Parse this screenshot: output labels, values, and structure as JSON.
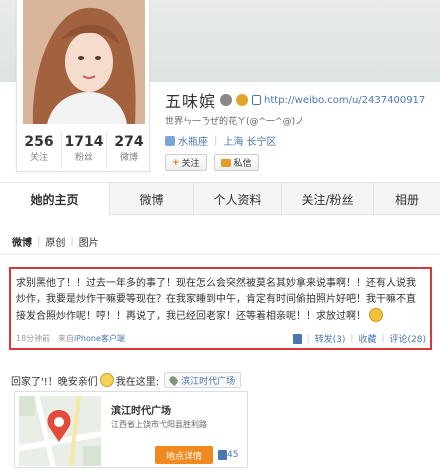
{
  "profile": {
    "name": "五味嫔",
    "weibo_url": "http://weibo.com/u/2437400917",
    "motto": "世界ㄣ一ㄋぜ的花ㄚ(@^一^@)ノ",
    "stats": [
      {
        "value": "256",
        "label": "关注"
      },
      {
        "value": "1714",
        "label": "粉丝"
      },
      {
        "value": "274",
        "label": "微博"
      }
    ],
    "tags": [
      "水瓶座",
      "上海 长宁区"
    ],
    "follow_label": "关注",
    "message_label": "私信"
  },
  "tabs": [
    {
      "label": "她的主页",
      "active": true
    },
    {
      "label": "微博",
      "active": false
    },
    {
      "label": "个人资料",
      "active": false
    },
    {
      "label": "关注/粉丝",
      "active": false
    },
    {
      "label": "相册",
      "active": false
    }
  ],
  "subnav": [
    "微博",
    "原创",
    "图片"
  ],
  "post": {
    "text": "求别黑他了！！过去一年多的事了！现在怎么会突然被莫名其妙拿来说事啊！！还有人说我炒作，我要是炒作干嘛要等现在？在我家睡到中午，肯定有时间偷拍照片好吧！我干嘛不直接发合照炒作呢！哼！！再说了，我已经回老家！还等着相亲呢！！求放过啊！",
    "time": "18分钟前",
    "source_prefix": "来自",
    "source": "iPhone客户端",
    "actions": {
      "like": "",
      "repost": "转发(3)",
      "favorite": "收藏",
      "comment": "评论(28)"
    }
  },
  "post2": {
    "text_before": "回家了'!！晚安亲们",
    "text_after": "我在这里:",
    "location_chip": "滨江时代广场",
    "location_card": {
      "title": "滨江时代广场",
      "address": "江西省上饶市弋阳县胜利路",
      "detail_button": "地点详情",
      "like_count": "45"
    }
  }
}
